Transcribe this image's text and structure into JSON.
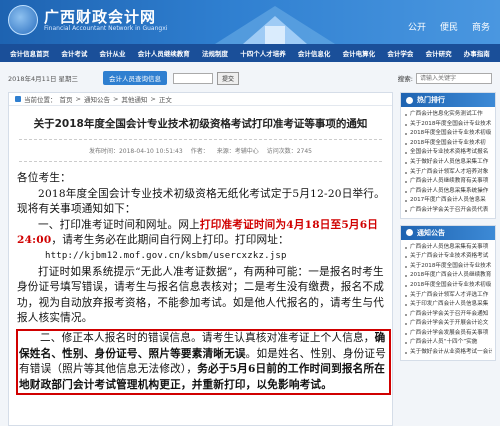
{
  "header": {
    "site_title": "广西财政会计网",
    "site_subtitle": "Financial Accountant Network in Guangxi",
    "links": [
      "公开",
      "便民",
      "商务"
    ]
  },
  "nav": [
    "会计信息首页",
    "会计考试",
    "会计从业",
    "会计人员继续教育",
    "法规制度",
    "十四个人才培养",
    "会计信息化",
    "会计电算化",
    "会计学会",
    "会计研究",
    "办事指南"
  ],
  "toolbar": {
    "date": "2018年4月11日 星期三",
    "tag_label": "会计人员查询信息",
    "select_value": "",
    "submit_label": "提交",
    "search_label": "搜索:",
    "search_placeholder": "请输入关键字"
  },
  "breadcrumb": [
    "当前位置：",
    "首页",
    ">",
    "通知公告",
    ">",
    "其他通知",
    ">",
    "正文"
  ],
  "article": {
    "title": "关于2018年度全国会计专业技术初级资格考试打印准考证等事项的通知",
    "meta": [
      "发布时间：2018-04-10 10:51:43",
      "作者：",
      "来源：考辅中心",
      "访问次数：2745"
    ],
    "greeting": "各位考生：",
    "intro": "2018年度全国会计专业技术初级资格无纸化考试定于5月12-20日举行。现将有关事项通知如下：",
    "p1_a": "一、打印准考证时间和网址。网上",
    "p1_red": "打印准考证时间为4月18日至5月6日24:00",
    "p1_b": "，请考生务必在此期间自行网上打印。打印网址：",
    "url": "http://kjbm12.mof.gov.cn/ksbm/usercxzkz.jsp",
    "p2": "打证时如果系统提示“无此人准考证数据”，有两种可能：一是报名时考生身份证号填写错误，请考生与报名信息表核对；二是考生没有缴费，报名不成功，视为自动放弃报考资格，不能参加考试。如是他人代报名的，请考生与代报人核实情况。",
    "p3_a": "二、修正本人报名时的错误信息。请考生认真核对准考证上个人信息，",
    "p3_b1": "确保姓名、性别、身份证号、照片等要素清晰无误",
    "p3_c": "。如是姓名、性别、身份证号有错误（照片等其他信息无法修改），",
    "p3_b2": "务必于5月6日前的工作时间到报名所在地财政部门会计考试管理机构更正，并重新打印，以免影响考试。"
  },
  "sidebar": {
    "hot_title": "热门排行",
    "hot_items": [
      "广西会计信息化实务测试工作",
      "关于2018年度全国会计专业技术",
      "2018年度全国会计专业技术初级",
      "2018年度全国会计专业技术初",
      "全国会计专业技术资格考试报名",
      "关于做好会计人员信息采集工作",
      "关于广西会计领军人才培养对象",
      "广西会计人员继续教育有关事项",
      "广西会计人员信息采集系统操作",
      "2017年度广西会计人员信息采",
      "广西会计学会关于召开会员代表"
    ],
    "notice_title": "通知公告",
    "notice_items": [
      "广西会计人员信息采集有关事项",
      "关于广西会计专业技术资格考试",
      "关于2018年度全国会计专业技术",
      "2018年度广西会计人员继续教育",
      "2018年度全国会计专业技术初级",
      "关于广西会计领军人才评选工作",
      "关于印发广西会计人员信息采集",
      "广西会计学会关于召开年会通知",
      "广西会计学会关于开展会计论文",
      "广西会计学会发展会员有关事项",
      "广西会计人员“十四个”实施",
      "关于做好会计从业资格考试一会计从业"
    ]
  }
}
